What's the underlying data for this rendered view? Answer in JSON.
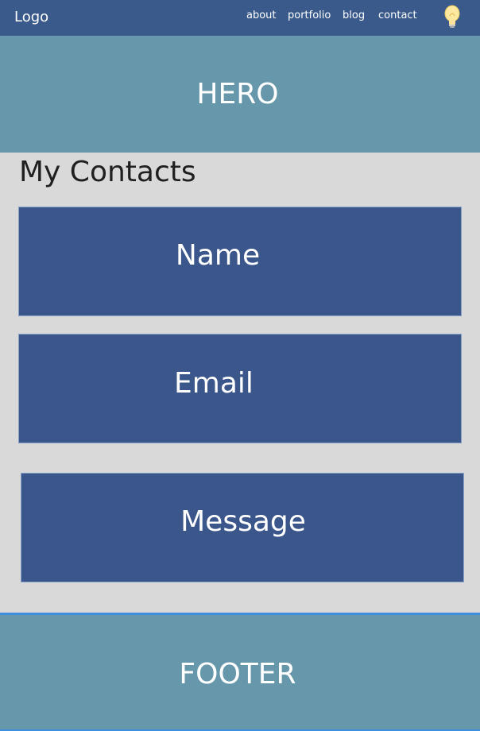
{
  "nav": {
    "logo": "Logo",
    "links": [
      "about",
      "portfolio",
      "blog",
      "contact"
    ],
    "theme_icon": "lightbulb-icon"
  },
  "hero": {
    "text": "HERO"
  },
  "contacts": {
    "title": "My Contacts",
    "fields": [
      "Name",
      "Email",
      "Message"
    ]
  },
  "footer": {
    "text": "FOOTER"
  },
  "colors": {
    "navbar": "#3a5a8c",
    "hero": "#6697aa",
    "field": "#3a568b",
    "page_bg": "#d9d9d9",
    "footer_border": "#3f8fe0"
  }
}
